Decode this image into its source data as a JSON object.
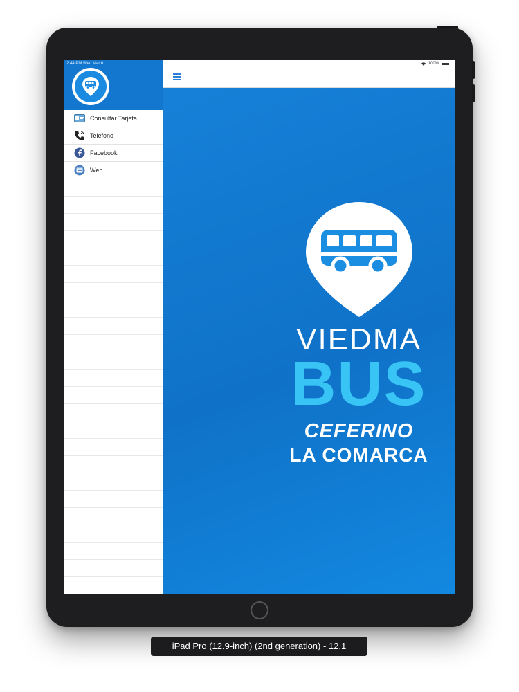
{
  "status_bar": {
    "time": "2:44 PM   Wed Mar 6",
    "battery": "100%"
  },
  "sidebar": {
    "items": [
      {
        "label": "Consultar Tarjeta",
        "icon": "card-icon"
      },
      {
        "label": "Telefono",
        "icon": "phone-icon"
      },
      {
        "label": "Facebook",
        "icon": "facebook-icon"
      },
      {
        "label": "Web",
        "icon": "web-icon"
      }
    ]
  },
  "topbar": {
    "menu_icon": "hamburger-icon"
  },
  "splash": {
    "line1": "VIEDMA",
    "line2": "BUS",
    "line3": "CEFERINO",
    "line4": "LA COMARCA"
  },
  "device_caption": "iPad Pro (12.9-inch) (2nd generation) - 12.1",
  "colors": {
    "brand_blue": "#1377cf",
    "bus_cyan": "#38c4f4",
    "splash_blue": "#1680d8"
  }
}
